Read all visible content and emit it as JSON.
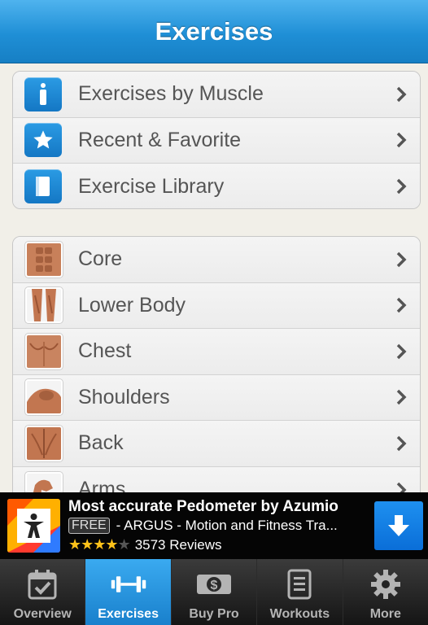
{
  "header": {
    "title": "Exercises"
  },
  "menu_top": [
    {
      "label": "Exercises by Muscle",
      "icon": "person-icon"
    },
    {
      "label": "Recent & Favorite",
      "icon": "star-icon"
    },
    {
      "label": "Exercise Library",
      "icon": "book-icon"
    }
  ],
  "muscle_groups": [
    {
      "label": "Core",
      "icon": "abs-thumbnail"
    },
    {
      "label": "Lower Body",
      "icon": "legs-thumbnail"
    },
    {
      "label": "Chest",
      "icon": "chest-thumbnail"
    },
    {
      "label": "Shoulders",
      "icon": "shoulders-thumbnail"
    },
    {
      "label": "Back",
      "icon": "back-thumbnail"
    },
    {
      "label": "Arms",
      "icon": "arms-thumbnail"
    }
  ],
  "ad": {
    "title": "Most accurate Pedometer by Azumio",
    "badge": "FREE",
    "subtitle": "- ARGUS - Motion and Fitness Tra...",
    "rating_stars": 4,
    "rating_max": 5,
    "reviews": "3573 Reviews",
    "download_icon": "download-arrow-icon"
  },
  "tabs": [
    {
      "label": "Overview",
      "icon": "calendar-check-icon",
      "active": false
    },
    {
      "label": "Exercises",
      "icon": "dumbbell-icon",
      "active": true
    },
    {
      "label": "Buy Pro",
      "icon": "dollar-bill-icon",
      "active": false
    },
    {
      "label": "Workouts",
      "icon": "clipboard-icon",
      "active": false
    },
    {
      "label": "More",
      "icon": "gear-icon",
      "active": false
    }
  ],
  "colors": {
    "accent": "#1f8fd6",
    "tab_active": "#2a95df",
    "star": "#ffc21a"
  }
}
